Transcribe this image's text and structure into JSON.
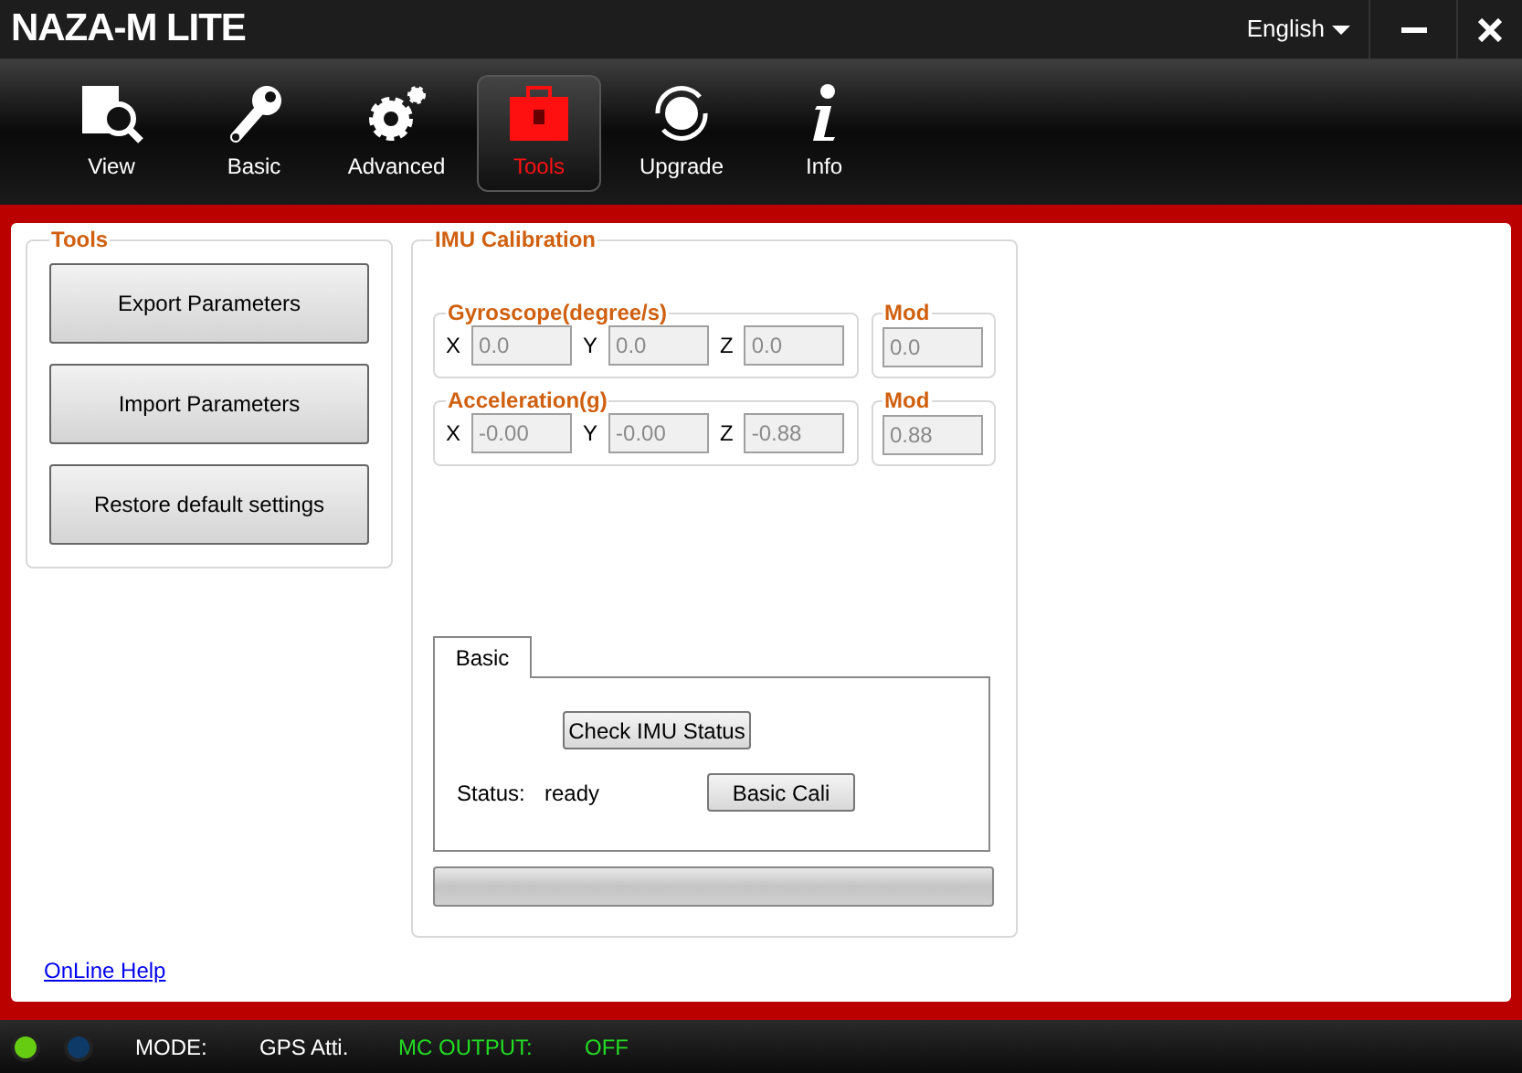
{
  "window": {
    "title": "NAZA-M LITE",
    "language": "English"
  },
  "nav": [
    {
      "label": "View",
      "kind": "view",
      "selected": false
    },
    {
      "label": "Basic",
      "kind": "basic",
      "selected": false
    },
    {
      "label": "Advanced",
      "kind": "advanced",
      "selected": false
    },
    {
      "label": "Tools",
      "kind": "tools",
      "selected": true
    },
    {
      "label": "Upgrade",
      "kind": "upgrade",
      "selected": false
    },
    {
      "label": "Info",
      "kind": "info",
      "selected": false
    }
  ],
  "tools": {
    "title": "Tools",
    "buttons": [
      "Export Parameters",
      "Import Parameters",
      "Restore default settings"
    ]
  },
  "imu": {
    "title": "IMU Calibration",
    "groups": [
      {
        "title": "Gyroscope(degree/s)",
        "axes": [
          {
            "label": "X",
            "value": "0.0"
          },
          {
            "label": "Y",
            "value": "0.0"
          },
          {
            "label": "Z",
            "value": "0.0"
          }
        ],
        "mod_title": "Mod",
        "mod": "0.0"
      },
      {
        "title": "Acceleration(g)",
        "axes": [
          {
            "label": "X",
            "value": "-0.00"
          },
          {
            "label": "Y",
            "value": "-0.00"
          },
          {
            "label": "Z",
            "value": "-0.88"
          }
        ],
        "mod_title": "Mod",
        "mod": "0.88"
      }
    ],
    "tabs": [
      {
        "label": "Basic",
        "selected": true
      }
    ],
    "check_button": "Check IMU Status",
    "status_label": "Status:",
    "status": "ready",
    "cali_button": "Basic Cali",
    "progress": {
      "level": 0
    }
  },
  "help_link": "OnLine Help",
  "status_bar": {
    "lights": [
      {
        "color": "#66cc11"
      },
      {
        "color": "#0d3a66"
      }
    ],
    "mode_label": "MODE:",
    "mode": "GPS Atti.",
    "output_label": "MC OUTPUT:",
    "output": "OFF"
  }
}
